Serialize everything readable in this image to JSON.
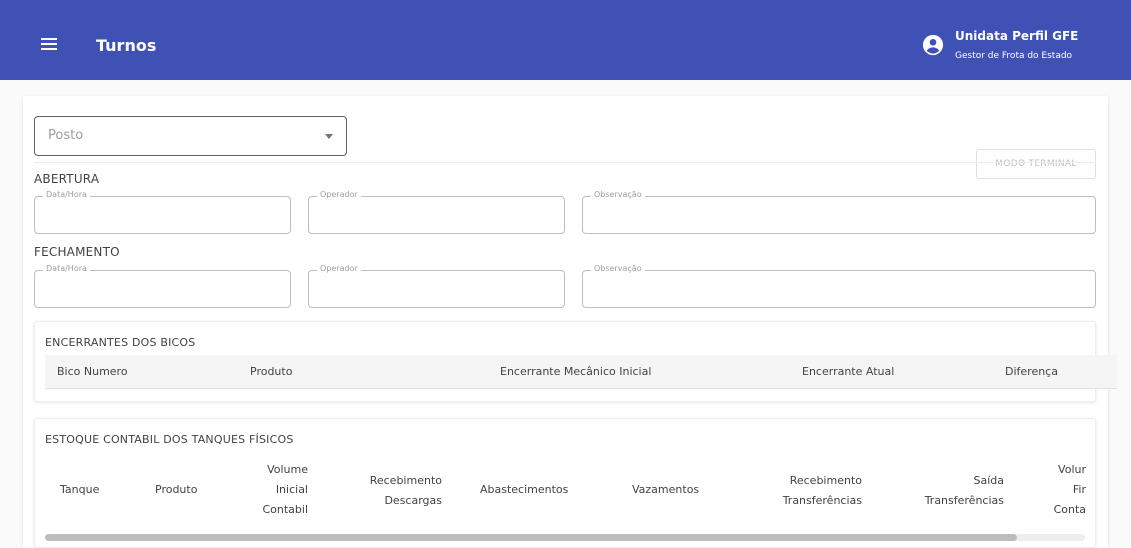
{
  "appbar": {
    "title": "Turnos",
    "user_name": "Unidata Perfil GFE",
    "user_role": "Gestor de Frota do Estado"
  },
  "filters": {
    "posto_label": "Posto",
    "terminal_button": "MODO TERMINAL"
  },
  "abertura": {
    "title": "ABERTURA",
    "datahora_label": "Data/Hora",
    "operador_label": "Operador",
    "observacao_label": "Observação"
  },
  "fechamento": {
    "title": "FECHAMENTO",
    "datahora_label": "Data/Hora",
    "operador_label": "Operador",
    "observacao_label": "Observação"
  },
  "encerrantes": {
    "title": "ENCERRANTES DOS BICOS",
    "columns": [
      "Bico Numero",
      "Produto",
      "Encerrante Mecânico Inicial",
      "Encerrante Atual",
      "Diferença"
    ]
  },
  "estoque": {
    "title": "ESTOQUE CONTABIL DOS TANQUES FÍSICOS",
    "columns": [
      [
        "Tanque"
      ],
      [
        "Produto"
      ],
      [
        "Volume",
        "Inicial",
        "Contabil"
      ],
      [
        "Recebimento",
        "Descargas"
      ],
      [
        "Abastecimentos"
      ],
      [
        "Vazamentos"
      ],
      [
        "Recebimento",
        "Transferências"
      ],
      [
        "Saída",
        "Transferências"
      ],
      [
        "Volur",
        "Fir",
        "Conta"
      ]
    ]
  },
  "colors": {
    "primary": "#3f51b5",
    "header_bg": "#f5f5f5"
  }
}
